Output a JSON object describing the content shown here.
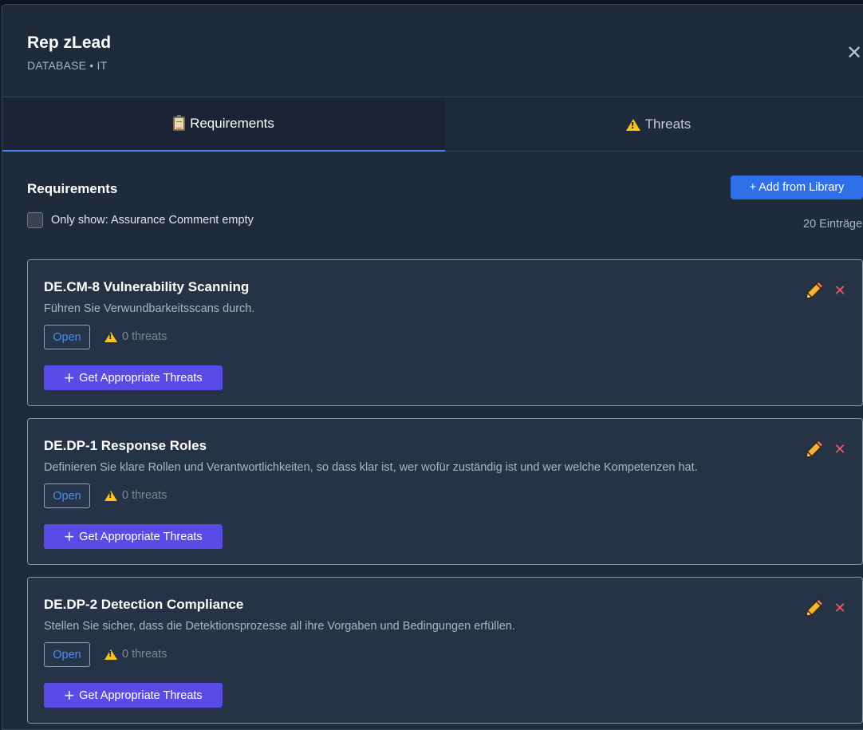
{
  "header": {
    "title": "Rep zLead",
    "subtitle": "DATABASE • IT",
    "close_label": "✕"
  },
  "tabs": [
    {
      "label": "Requirements",
      "icon": "clipboard-icon",
      "active": true
    },
    {
      "label": "Threats",
      "icon": "warning-icon",
      "active": false
    }
  ],
  "section": {
    "title": "Requirements",
    "add_label": "+ Add from Library",
    "filter_label": "Only show: Assurance Comment empty",
    "filter_checked": false,
    "entries_label": "20 Einträge"
  },
  "cards": [
    {
      "title": "DE.CM-8 Vulnerability Scanning",
      "description": "Führen Sie Verwundbarkeitsscans durch.",
      "status": "Open",
      "threats": "0 threats",
      "action_label": "Get Appropriate Threats"
    },
    {
      "title": "DE.DP-1 Response Roles",
      "description": "Definieren Sie klare Rollen und Verantwortlichkeiten, so dass klar ist, wer wofür zuständig ist und wer welche Kompetenzen hat.",
      "status": "Open",
      "threats": "0 threats",
      "action_label": "Get Appropriate Threats"
    },
    {
      "title": "DE.DP-2 Detection Compliance",
      "description": "Stellen Sie sicher, dass die Detektionsprozesse all ihre Vorgaben und Bedingungen erfüllen.",
      "status": "Open",
      "threats": "0 threats",
      "action_label": "Get Appropriate Threats"
    }
  ],
  "colors": {
    "panel_bg": "#1f2a3b",
    "card_bg": "#263245",
    "accent_blue": "#2f6fe8",
    "action_purple": "#5b4be6",
    "delete_red": "#f05a6a",
    "warning_yellow": "#f5c518"
  }
}
